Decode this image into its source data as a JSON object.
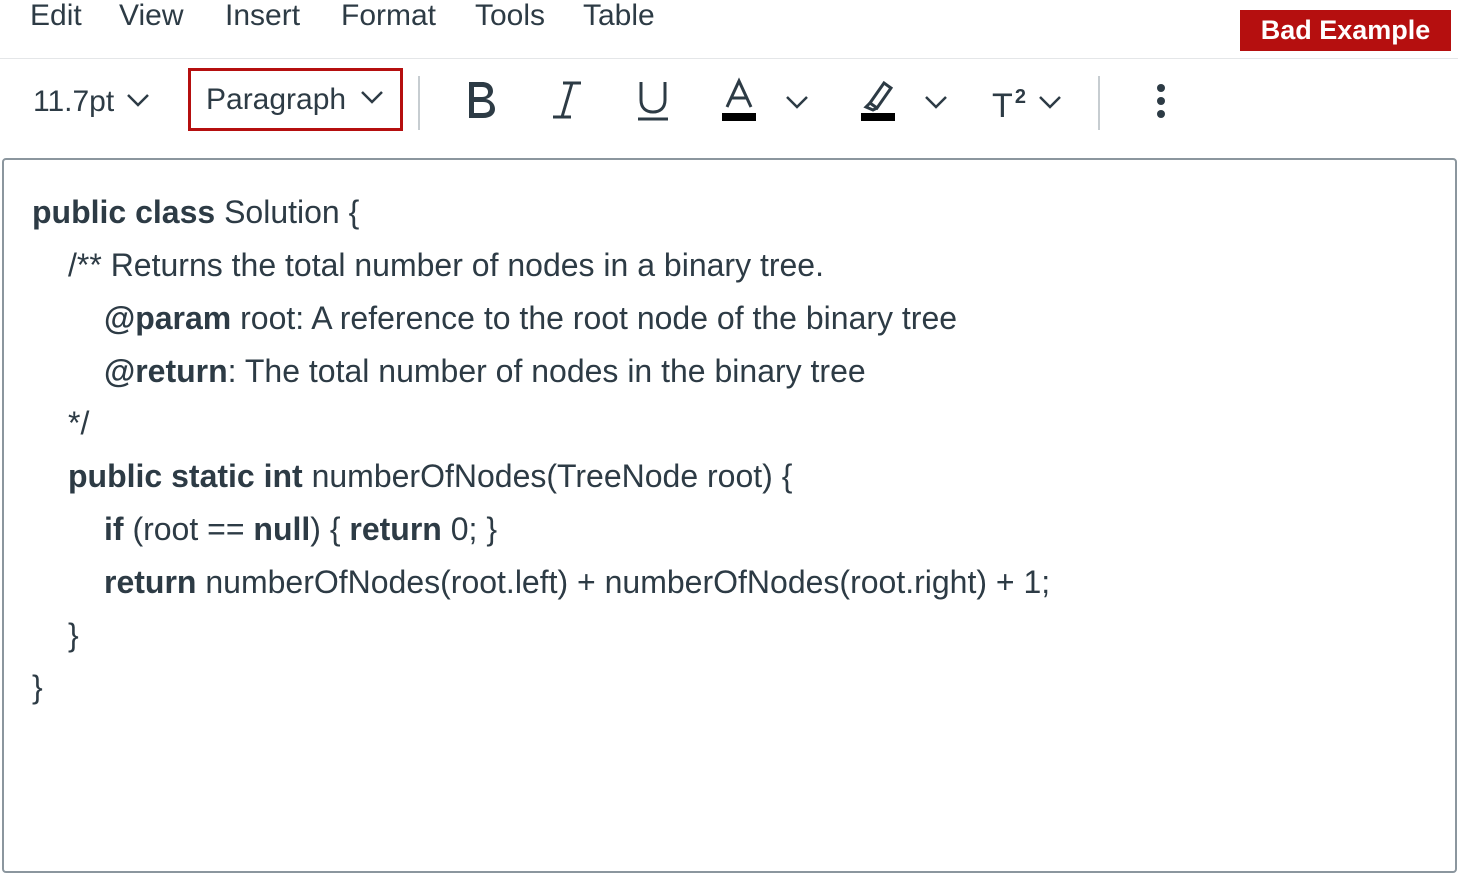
{
  "menubar": {
    "items": [
      "Edit",
      "View",
      "Insert",
      "Format",
      "Tools",
      "Table"
    ]
  },
  "badge": {
    "label": "Bad Example",
    "color": "#b50f0f"
  },
  "toolbar": {
    "font_size": "11.7pt",
    "block_format": "Paragraph",
    "superscript_base": "T",
    "superscript_exp": "2",
    "icons": [
      "bold-icon",
      "italic-icon",
      "underline-icon",
      "text-color-icon",
      "highlight-icon",
      "superscript-icon",
      "more-icon"
    ]
  },
  "editor": {
    "lines": [
      {
        "kw": "public class",
        "text": " Solution {"
      },
      {
        "kw": "",
        "text": "/** Returns the total number of nodes in a binary tree."
      },
      {
        "kw": "@param",
        "text": " root: A reference to the root node of the binary tree"
      },
      {
        "kw": "@return",
        "text": ": The total number of nodes in the binary tree"
      },
      {
        "kw": "",
        "text": "*/"
      },
      {
        "kw": "public static int",
        "text": " numberOfNodes(TreeNode root) {"
      },
      {
        "kw": "if",
        "text": " (root == ",
        "kw2": "null",
        "text2": ") { ",
        "kw3": "return",
        "text3": " 0; }"
      },
      {
        "kw": "return",
        "text": " numberOfNodes(root.left) + numberOfNodes(root.right) + 1;"
      },
      {
        "kw": "",
        "text": "}"
      },
      {
        "kw": "",
        "text": "}"
      }
    ]
  }
}
